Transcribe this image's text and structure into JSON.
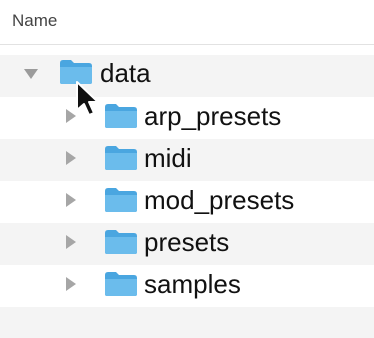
{
  "header": {
    "column_label": "Name"
  },
  "tree": {
    "root": {
      "label": "data",
      "expanded": true,
      "icon": "folder-icon"
    },
    "children": [
      {
        "label": "arp_presets",
        "expanded": false,
        "icon": "folder-icon"
      },
      {
        "label": "midi",
        "expanded": false,
        "icon": "folder-icon"
      },
      {
        "label": "mod_presets",
        "expanded": false,
        "icon": "folder-icon"
      },
      {
        "label": "presets",
        "expanded": false,
        "icon": "folder-icon"
      },
      {
        "label": "samples",
        "expanded": false,
        "icon": "folder-icon"
      }
    ]
  },
  "colors": {
    "folder_blue": "#5fb4e8",
    "folder_tab": "#7cc3ee",
    "stripe": "#f4f4f4",
    "disclosure": "#9b9b9b"
  }
}
